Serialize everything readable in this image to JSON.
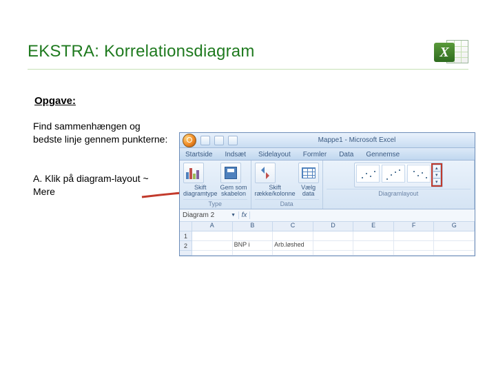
{
  "title": "EKSTRA: Korrelationsdiagram",
  "opgave_label": "Opgave:",
  "intro": "Find sammenhængen og bedste linje gennem punkterne:",
  "step_a": "A. Klik på diagram-layout ~ Mere",
  "excel": {
    "doc_title": "Mappe1 - Microsoft Excel",
    "tabs": [
      "Startside",
      "Indsæt",
      "Sidelayout",
      "Formler",
      "Data",
      "Gennemse"
    ],
    "ribbon": {
      "type_group": {
        "btn1": "Skift\ndiagramtype",
        "btn2": "Gem som\nskabelon",
        "name": "Type"
      },
      "data_group": {
        "btn1": "Skift\nrække/kolonne",
        "btn2": "Vælg\ndata",
        "name": "Data"
      },
      "layout_group": {
        "name": "Diagramlayout"
      }
    },
    "namebox": "Diagram 2",
    "fx_label": "fx",
    "columns": [
      "A",
      "B",
      "C",
      "D",
      "E",
      "F",
      "G"
    ],
    "rows": {
      "r1": "1",
      "r2": "2",
      "b2": "BNP i",
      "c2": "Arb.løshed"
    }
  }
}
